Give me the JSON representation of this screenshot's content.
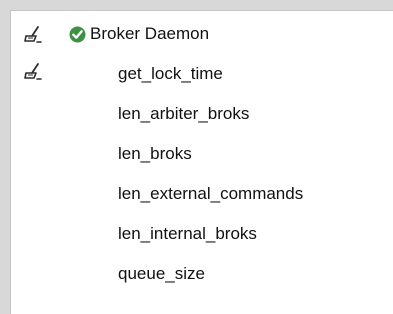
{
  "tree": {
    "root": {
      "label": "Broker Daemon",
      "icons": [
        "broom-icon",
        "check-circle-icon"
      ],
      "status": "ok"
    },
    "children": [
      {
        "label": "get_lock_time",
        "icon": "broom-icon"
      },
      {
        "label": "len_arbiter_broks"
      },
      {
        "label": "len_broks"
      },
      {
        "label": "len_external_commands"
      },
      {
        "label": "len_internal_broks"
      },
      {
        "label": "queue_size"
      }
    ]
  },
  "colors": {
    "status_ok": "#3f8f45",
    "icon_stroke": "#2b2b2b",
    "background": "#d8d8d8",
    "panel": "#ffffff"
  }
}
